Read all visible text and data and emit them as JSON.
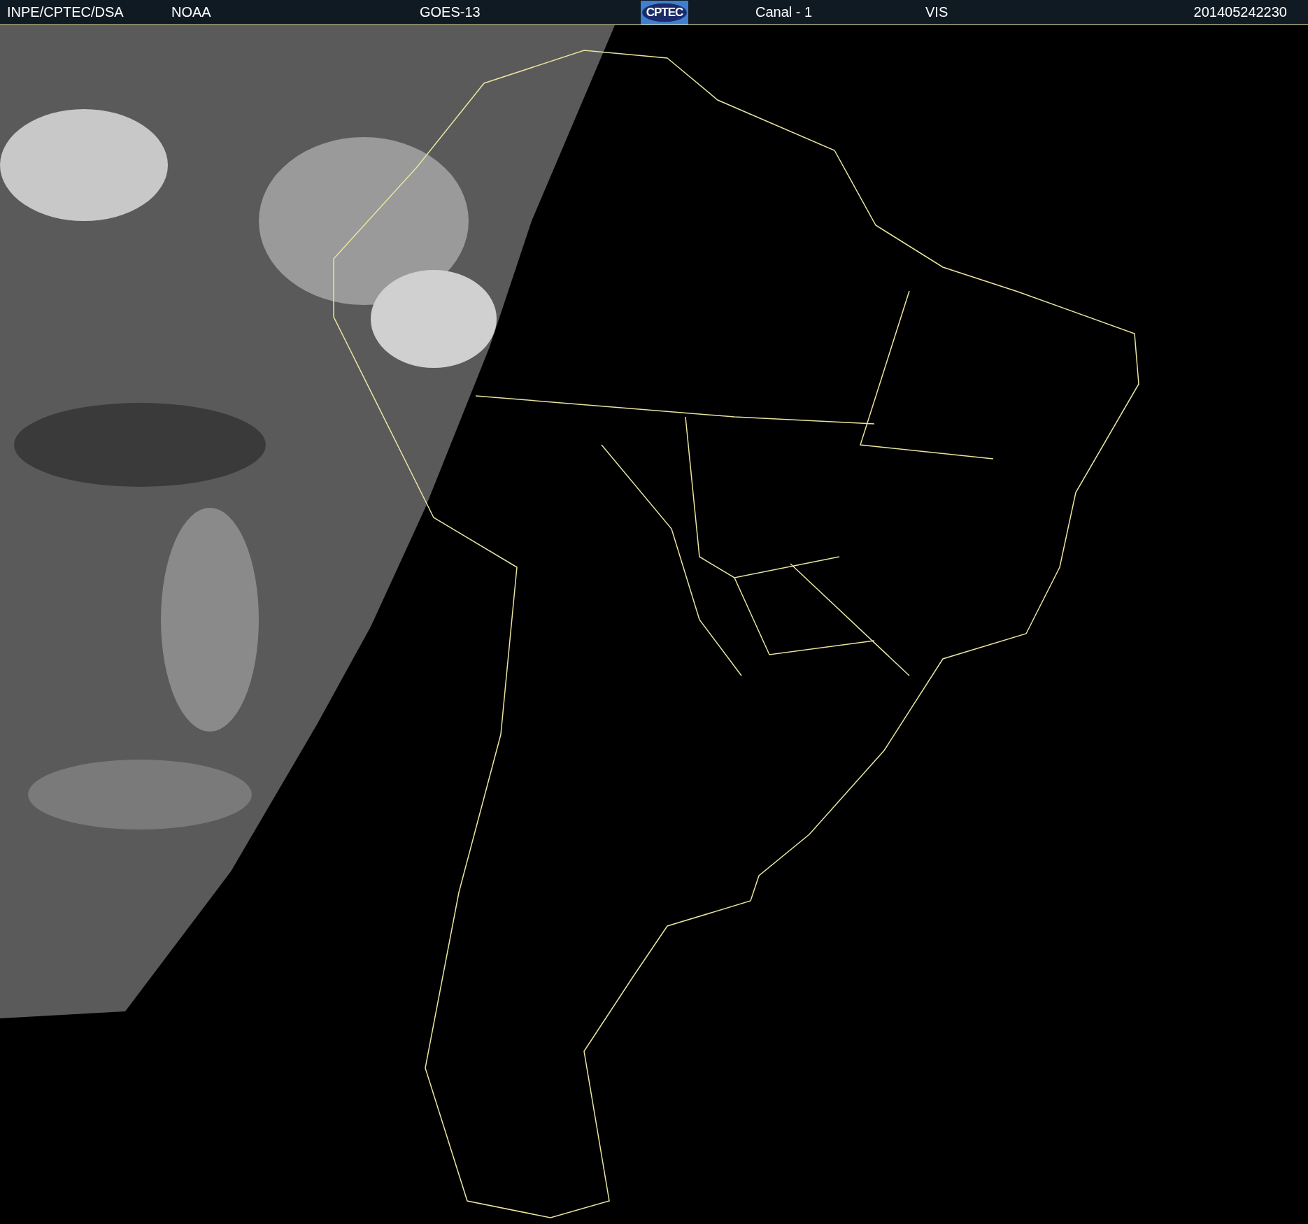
{
  "header": [
    {
      "kind": "text",
      "text": "INPE/CPTEC/DSA"
    },
    {
      "kind": "text",
      "text": "NOAA"
    },
    {
      "kind": "text",
      "text": "GOES-13"
    },
    {
      "kind": "logo",
      "text": "CPTEC"
    },
    {
      "kind": "text",
      "text": "Canal - 1"
    },
    {
      "kind": "text",
      "text": "VIS"
    },
    {
      "kind": "text",
      "text": "201405242230"
    }
  ]
}
